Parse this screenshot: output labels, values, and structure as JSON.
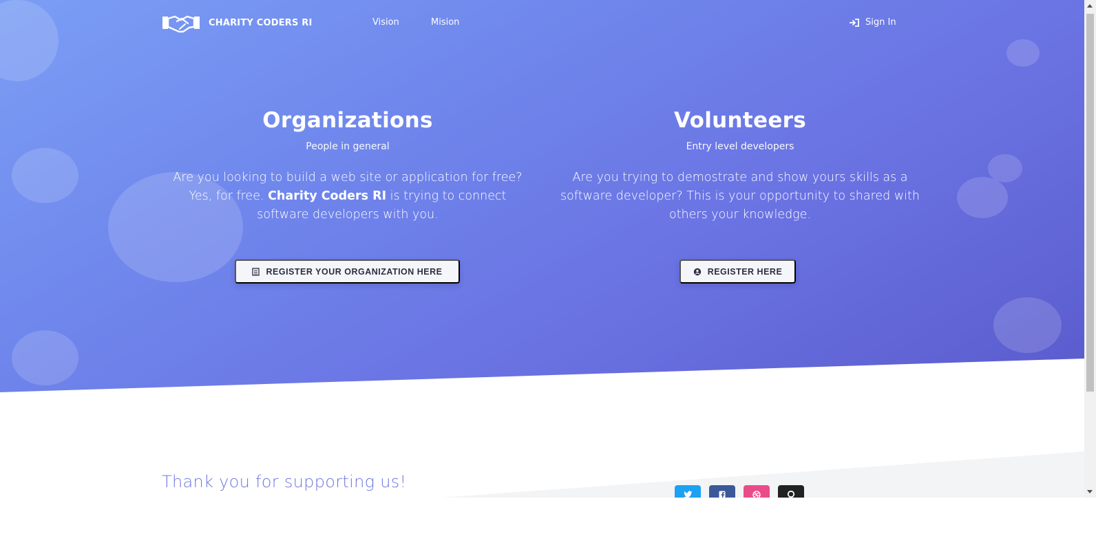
{
  "brand": {
    "name": "CHARITY CODERS RI",
    "logo_icon": "handshake-icon"
  },
  "nav": {
    "links": [
      {
        "label": "Vision"
      },
      {
        "label": "Mision"
      }
    ],
    "signin": {
      "label": "Sign In",
      "icon": "sign-in-icon"
    }
  },
  "organizations": {
    "title": "Organizations",
    "subtitle": "People in general",
    "text_before": "Are you looking to build a web site or application for free? Yes, for free. ",
    "text_bold": "Charity Coders RI",
    "text_after": " is trying to connect software developers with you.",
    "button": {
      "label": "REGISTER YOUR ORGANIZATION HERE",
      "icon": "building-icon"
    }
  },
  "volunteers": {
    "title": "Volunteers",
    "subtitle": "Entry level developers",
    "text": "Are you trying to demostrate and show yours skills as a software developer? This is your opportunity to shared with others your knowledge.",
    "button": {
      "label": "REGISTER HERE",
      "icon": "user-badge-icon"
    }
  },
  "footer": {
    "thanks": "Thank you for supporting us!",
    "social": [
      {
        "name": "twitter",
        "icon": "twitter-icon",
        "color": "#1da1f2"
      },
      {
        "name": "facebook",
        "icon": "facebook-icon",
        "color": "#3b5998"
      },
      {
        "name": "dribbble",
        "icon": "dribbble-icon",
        "color": "#ea4c89"
      },
      {
        "name": "github",
        "icon": "github-icon",
        "color": "#222222"
      }
    ]
  },
  "colors": {
    "hero_start": "#7b9ef5",
    "hero_end": "#5a5bcc",
    "accent_text": "#6e77e0",
    "button_bg": "#f5f6fa"
  }
}
